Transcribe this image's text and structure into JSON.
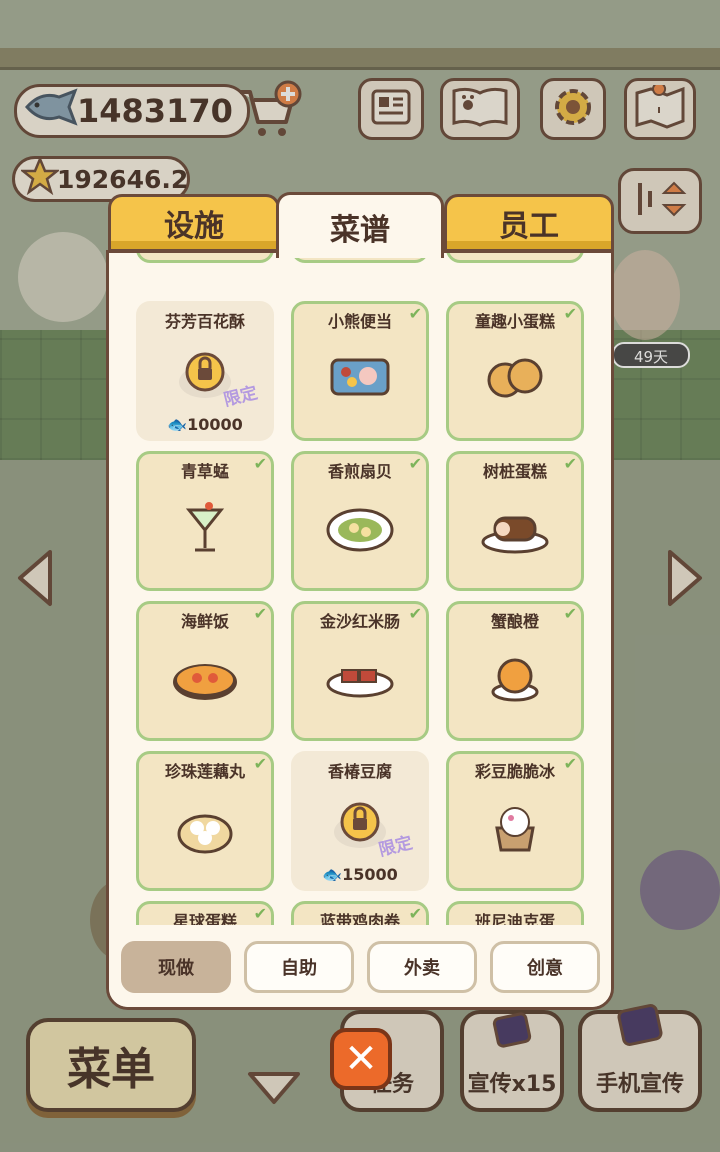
{
  "hud": {
    "fish_amount": "1483170",
    "star_amount": "192646.2",
    "days": "49天"
  },
  "panel": {
    "tabs": [
      {
        "label": "设施",
        "active": false
      },
      {
        "label": "菜谱",
        "active": true
      },
      {
        "label": "员工",
        "active": false
      }
    ],
    "recipes": [
      {
        "name": "芬芳百花酥",
        "unlocked": false,
        "limited": "限定",
        "price": "10000"
      },
      {
        "name": "小熊便当",
        "unlocked": true
      },
      {
        "name": "童趣小蛋糕",
        "unlocked": true
      },
      {
        "name": "青草蜢",
        "unlocked": true
      },
      {
        "name": "香煎扇贝",
        "unlocked": true
      },
      {
        "name": "树桩蛋糕",
        "unlocked": true
      },
      {
        "name": "海鲜饭",
        "unlocked": true
      },
      {
        "name": "金沙红米肠",
        "unlocked": true
      },
      {
        "name": "蟹酿橙",
        "unlocked": true
      },
      {
        "name": "珍珠莲藕丸",
        "unlocked": true
      },
      {
        "name": "香椿豆腐",
        "unlocked": false,
        "limited": "限定",
        "price": "15000"
      },
      {
        "name": "彩豆脆脆冰",
        "unlocked": true
      },
      {
        "name": "星球蛋糕",
        "unlocked": true
      },
      {
        "name": "蓝带鸡肉卷",
        "unlocked": true
      },
      {
        "name": "班尼迪克蛋",
        "unlocked": true
      }
    ],
    "filters": [
      {
        "label": "现做",
        "active": true
      },
      {
        "label": "自助",
        "active": false
      },
      {
        "label": "外卖",
        "active": false
      },
      {
        "label": "创意",
        "active": false
      }
    ]
  },
  "bottom": {
    "menu_label": "菜单",
    "task_label": "任务",
    "promo_label": "宣传x15",
    "phone_label": "手机宣传",
    "close_symbol": "✕"
  },
  "colors": {
    "card_border_unlocked": "#a7cb84",
    "tab_inactive": "#f5c44a",
    "panel_bg": "#fdf7ec",
    "limited_text": "#b49ae0",
    "close_button": "#ec6a2a"
  }
}
